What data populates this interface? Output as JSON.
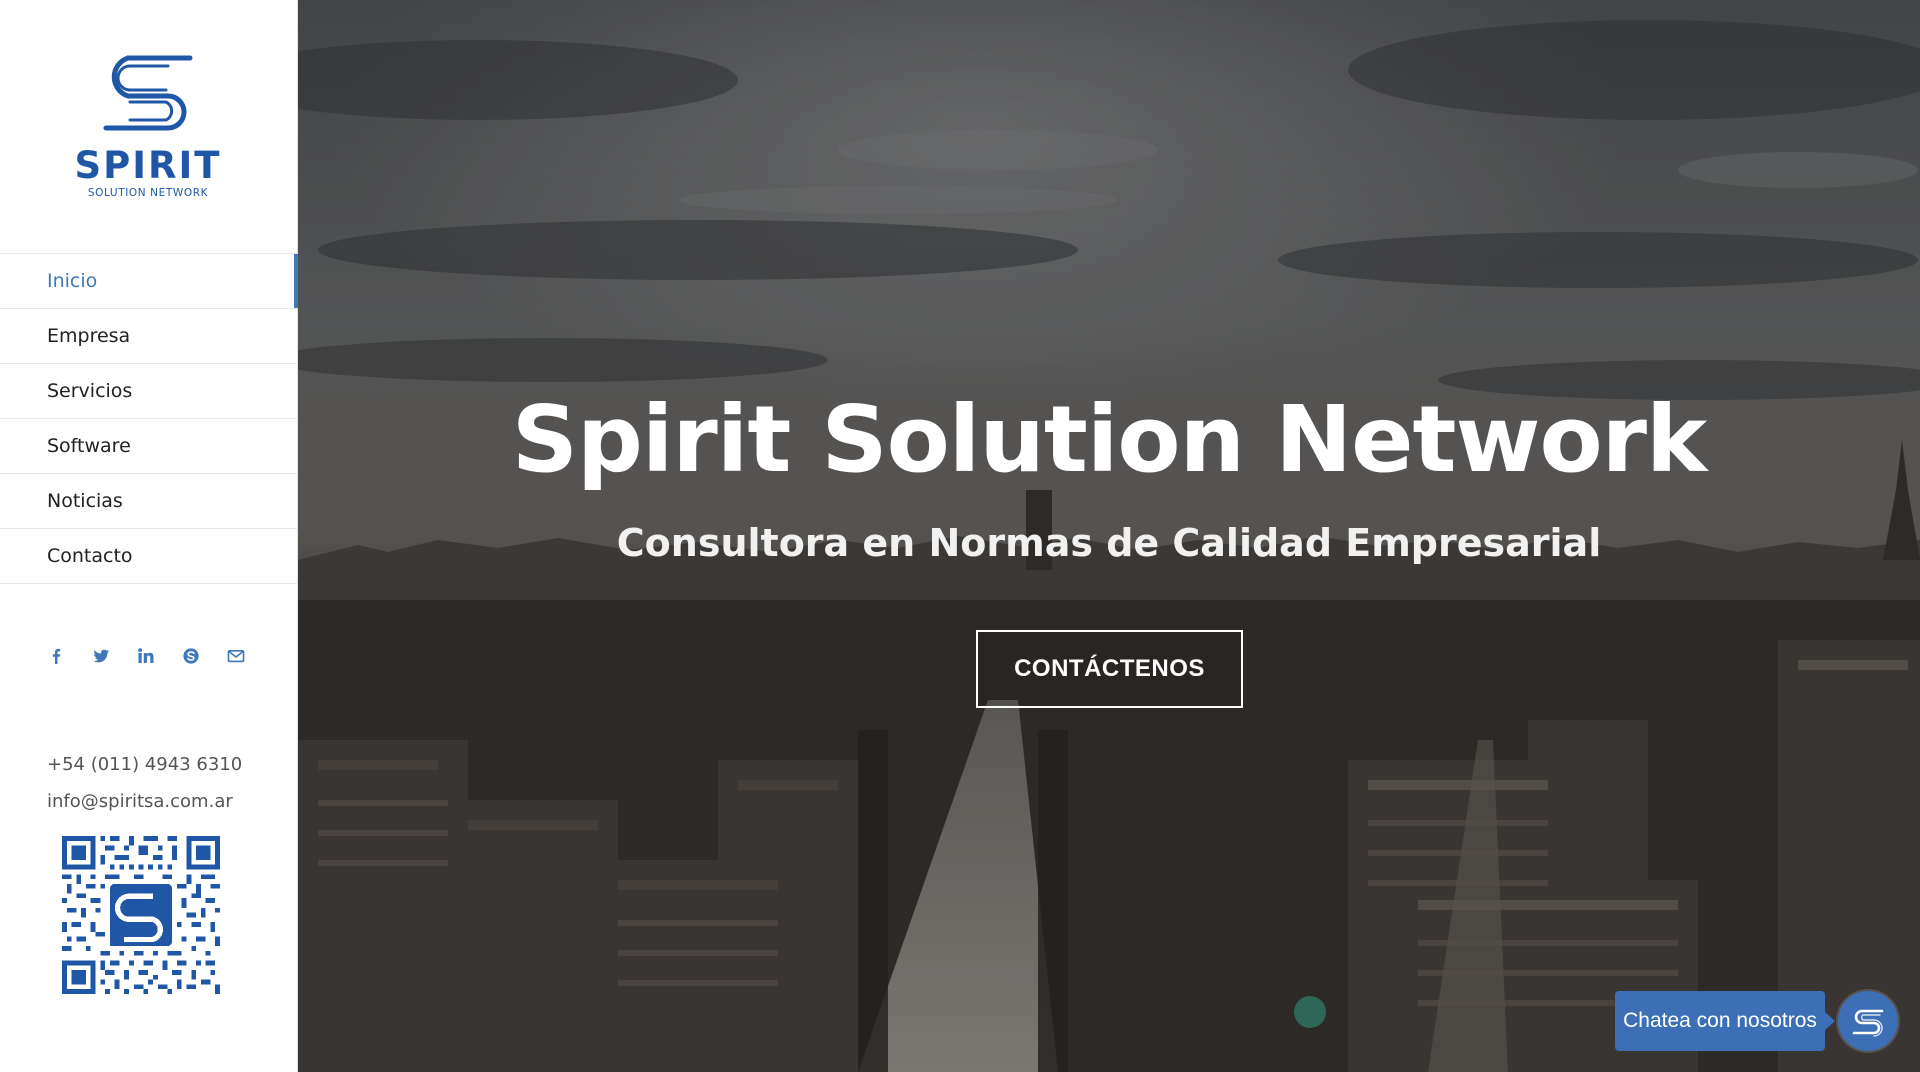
{
  "brand": {
    "name": "SPIRIT",
    "tagline": "SOLUTION NETWORK",
    "color": "#1f57a6"
  },
  "nav": {
    "active_color": "#3f79b8",
    "items": [
      {
        "label": "Inicio",
        "active": true
      },
      {
        "label": "Empresa",
        "active": false
      },
      {
        "label": "Servicios",
        "active": false
      },
      {
        "label": "Software",
        "active": false
      },
      {
        "label": "Noticias",
        "active": false
      },
      {
        "label": "Contacto",
        "active": false
      }
    ]
  },
  "social": {
    "icons": [
      "facebook-icon",
      "twitter-icon",
      "linkedin-icon",
      "skype-icon",
      "email-icon"
    ],
    "color": "#3f79b8"
  },
  "contact": {
    "phone": "+54 (011) 4943 6310",
    "email": "info@spiritsa.com.ar"
  },
  "hero": {
    "title": "Spirit Solution Network",
    "subtitle": "Consultora en Normas de Calidad Empresarial",
    "button_label": "CONTÁCTENOS"
  },
  "chat": {
    "label": "Chatea con nosotros",
    "color": "#3c6fb5"
  }
}
